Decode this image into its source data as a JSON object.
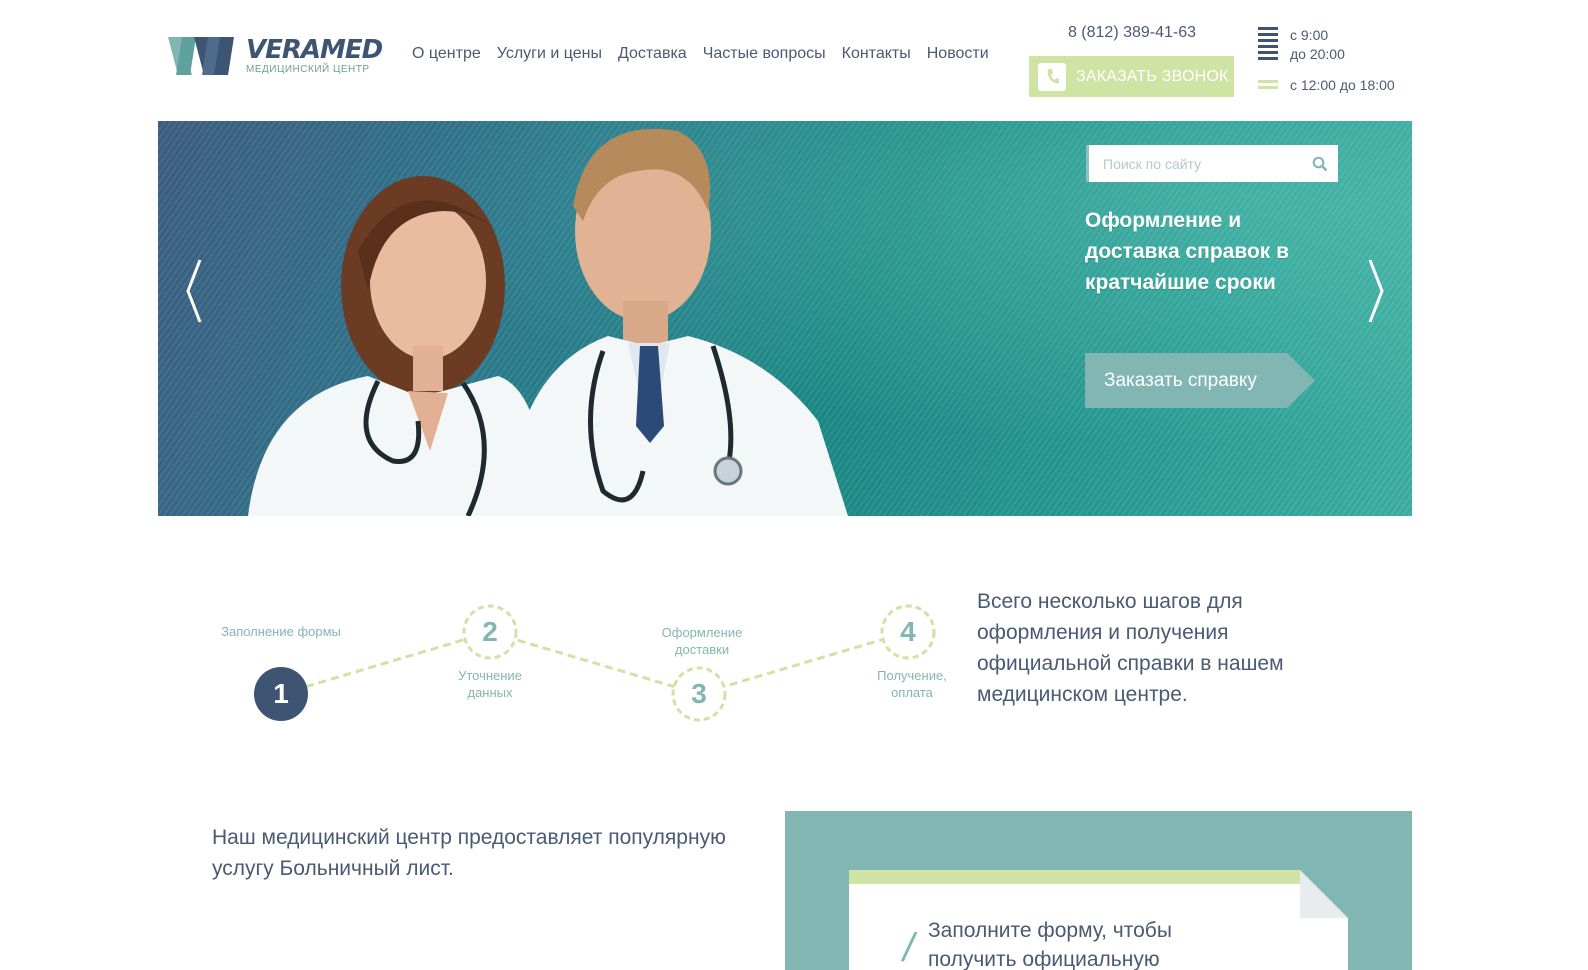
{
  "brand": {
    "name": "VERAMED",
    "tagline": "МЕДИЦИНСКИЙ ЦЕНТР",
    "logo_icon": "veramed-logo-mark"
  },
  "nav": {
    "items": [
      {
        "label": "О центре"
      },
      {
        "label": "Услуги и цены"
      },
      {
        "label": "Доставка"
      },
      {
        "label": "Частые вопросы"
      },
      {
        "label": "Контакты"
      },
      {
        "label": "Новости"
      }
    ]
  },
  "contact": {
    "phone": "8 (812) 389-41-63",
    "callback_label": "ЗАКАЗАТЬ ЗВОНОК",
    "callback_icon": "phone-handset-icon"
  },
  "hours": {
    "weekday_from": "с 9:00",
    "weekday_to": "до 20:00",
    "weekend": "с 12:00 до 18:00"
  },
  "hero": {
    "search_placeholder": "Поиск по сайту",
    "search_icon": "magnifier-icon",
    "title": "Оформление и доставка справок в кратчайшие сроки",
    "button_label": "Заказать справку"
  },
  "steps": {
    "items": [
      {
        "number": "1",
        "label": "Заполнение формы"
      },
      {
        "number": "2",
        "label": "Уточнение данных"
      },
      {
        "number": "3",
        "label": "Оформление доставки"
      },
      {
        "number": "4",
        "label": "Получение, оплата"
      }
    ],
    "description": "Всего несколько шагов для оформления и получения официальной справки в нашем медицинском центре."
  },
  "intro": {
    "text": "Наш медицинский центр предоставляет популярную услугу Больничный лист."
  },
  "form": {
    "title": "Заполните форму, чтобы получить официальную"
  },
  "colors": {
    "navy": "#3d5473",
    "teal": "#82b6b2",
    "lime": "#cfe3a4",
    "text": "#4a5a73"
  }
}
